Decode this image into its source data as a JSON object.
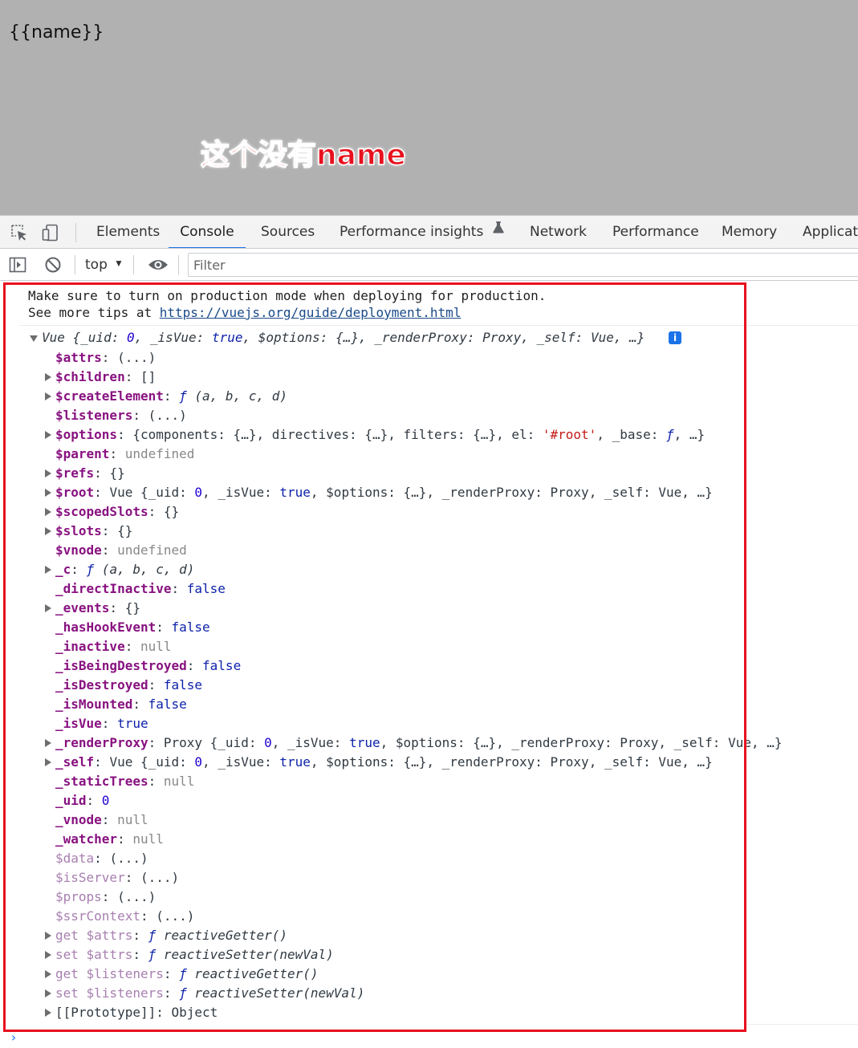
{
  "viewport": {
    "page_text": "{{name}}",
    "annotation": "这个没有name"
  },
  "devtools": {
    "icons": [
      "inspect-element-icon",
      "device-toolbar-icon"
    ],
    "tabs": [
      {
        "label": "Elements",
        "active": false
      },
      {
        "label": "Console",
        "active": true
      },
      {
        "label": "Sources",
        "active": false
      },
      {
        "label": "Performance insights",
        "active": false,
        "icon": "flask-icon"
      },
      {
        "label": "Network",
        "active": false
      },
      {
        "label": "Performance",
        "active": false
      },
      {
        "label": "Memory",
        "active": false
      },
      {
        "label": "Applicati",
        "active": false
      }
    ]
  },
  "console_toolbar": {
    "icons": [
      "sidebar-toggle-icon",
      "clear-console-icon",
      "live-expression-eye-icon"
    ],
    "context": "top",
    "filter_placeholder": "Filter"
  },
  "console": {
    "message_line1": "Make sure to turn on production mode when deploying for production.",
    "message_line2_prefix": "See more tips at ",
    "message_link": "https://vuejs.org/guide/deployment.html",
    "object_name": "Vue",
    "object_preview": " {_uid: 0, _isVue: true, $options: {…}, _renderProxy: Proxy, _self: Vue, …}",
    "info_badge": "i",
    "properties": [
      {
        "expand": false,
        "key": "$attrs",
        "style": "own",
        "value": "(...)",
        "vtype": "pn"
      },
      {
        "expand": true,
        "key": "$children",
        "style": "own",
        "value": "[]",
        "vtype": "pn"
      },
      {
        "expand": true,
        "key": "$createElement",
        "style": "own",
        "value": "ƒ (a, b, c, d)",
        "vtype": "fnsig"
      },
      {
        "expand": false,
        "key": "$listeners",
        "style": "own",
        "value": "(...)",
        "vtype": "pn"
      },
      {
        "expand": true,
        "key": "$options",
        "style": "own",
        "value": "{components: {…}, directives: {…}, filters: {…}, el: '#root', _base: ƒ, …}",
        "vtype": "options"
      },
      {
        "expand": false,
        "key": "$parent",
        "style": "own",
        "value": "undefined",
        "vtype": "nul"
      },
      {
        "expand": true,
        "key": "$refs",
        "style": "own",
        "value": "{}",
        "vtype": "pn"
      },
      {
        "expand": true,
        "key": "$root",
        "style": "own",
        "value": "Vue {_uid: 0, _isVue: true, $options: {…}, _renderProxy: Proxy, _self: Vue, …}",
        "vtype": "vue"
      },
      {
        "expand": true,
        "key": "$scopedSlots",
        "style": "own",
        "value": "{}",
        "vtype": "pn"
      },
      {
        "expand": true,
        "key": "$slots",
        "style": "own",
        "value": "{}",
        "vtype": "pn"
      },
      {
        "expand": false,
        "key": "$vnode",
        "style": "own",
        "value": "undefined",
        "vtype": "nul"
      },
      {
        "expand": true,
        "key": "_c",
        "style": "own",
        "value": "ƒ (a, b, c, d)",
        "vtype": "fnsig"
      },
      {
        "expand": false,
        "key": "_directInactive",
        "style": "own",
        "value": "false",
        "vtype": "bool"
      },
      {
        "expand": true,
        "key": "_events",
        "style": "own",
        "value": "{}",
        "vtype": "pn"
      },
      {
        "expand": false,
        "key": "_hasHookEvent",
        "style": "own",
        "value": "false",
        "vtype": "bool"
      },
      {
        "expand": false,
        "key": "_inactive",
        "style": "own",
        "value": "null",
        "vtype": "nul"
      },
      {
        "expand": false,
        "key": "_isBeingDestroyed",
        "style": "own",
        "value": "false",
        "vtype": "bool"
      },
      {
        "expand": false,
        "key": "_isDestroyed",
        "style": "own",
        "value": "false",
        "vtype": "bool"
      },
      {
        "expand": false,
        "key": "_isMounted",
        "style": "own",
        "value": "false",
        "vtype": "bool"
      },
      {
        "expand": false,
        "key": "_isVue",
        "style": "own",
        "value": "true",
        "vtype": "bool"
      },
      {
        "expand": true,
        "key": "_renderProxy",
        "style": "own",
        "value": "Proxy {_uid: 0, _isVue: true, $options: {…}, _renderProxy: Proxy, _self: Vue, …}",
        "vtype": "vue"
      },
      {
        "expand": true,
        "key": "_self",
        "style": "own",
        "value": "Vue {_uid: 0, _isVue: true, $options: {…}, _renderProxy: Proxy, _self: Vue, …}",
        "vtype": "vue"
      },
      {
        "expand": false,
        "key": "_staticTrees",
        "style": "own",
        "value": "null",
        "vtype": "nul"
      },
      {
        "expand": false,
        "key": "_uid",
        "style": "own",
        "value": "0",
        "vtype": "num"
      },
      {
        "expand": false,
        "key": "_vnode",
        "style": "own",
        "value": "null",
        "vtype": "nul"
      },
      {
        "expand": false,
        "key": "_watcher",
        "style": "own",
        "value": "null",
        "vtype": "nul"
      },
      {
        "expand": false,
        "key": "$data",
        "style": "inherited",
        "value": "(...)",
        "vtype": "pn"
      },
      {
        "expand": false,
        "key": "$isServer",
        "style": "inherited",
        "value": "(...)",
        "vtype": "pn"
      },
      {
        "expand": false,
        "key": "$props",
        "style": "inherited",
        "value": "(...)",
        "vtype": "pn"
      },
      {
        "expand": false,
        "key": "$ssrContext",
        "style": "inherited",
        "value": "(...)",
        "vtype": "pn"
      },
      {
        "expand": true,
        "key": "get $attrs",
        "style": "inherited",
        "value": "ƒ reactiveGetter()",
        "vtype": "fn"
      },
      {
        "expand": true,
        "key": "set $attrs",
        "style": "inherited",
        "value": "ƒ reactiveSetter(newVal)",
        "vtype": "fn"
      },
      {
        "expand": true,
        "key": "get $listeners",
        "style": "inherited",
        "value": "ƒ reactiveGetter()",
        "vtype": "fn"
      },
      {
        "expand": true,
        "key": "set $listeners",
        "style": "inherited",
        "value": "ƒ reactiveSetter(newVal)",
        "vtype": "fn"
      },
      {
        "expand": true,
        "key": "[[Prototype]]",
        "style": "proto",
        "value": "Object",
        "vtype": "pn"
      }
    ]
  },
  "colors": {
    "annotation_red": "#e8101e",
    "accent_blue": "#1a73e8",
    "key_purple": "#881280",
    "boolean_blue": "#0d22aa",
    "string_red": "#c41a16"
  }
}
